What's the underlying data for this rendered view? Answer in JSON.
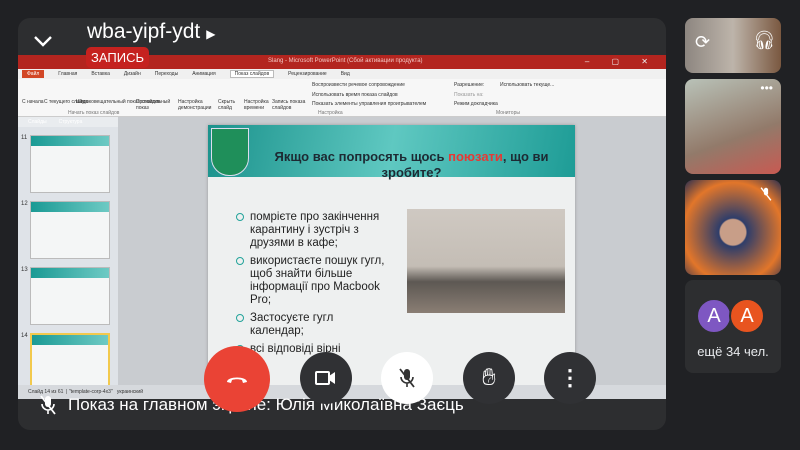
{
  "meeting": {
    "code": "wba-yipf-ydt",
    "recording_label": "ЗАПИСЬ",
    "presenting_caption": "Показ на главном экране: Юлія Миколаївна Заєць"
  },
  "powerpoint": {
    "window_title": "Slang - Microsoft PowerPoint (Сбой активации продукта)",
    "tabs": [
      "Файл",
      "Главная",
      "Вставка",
      "Дизайн",
      "Переходы",
      "Анимация",
      "Показ слайдов",
      "Рецензирование",
      "Вид"
    ],
    "active_tab": "Показ слайдов",
    "ribbon": {
      "start_group": {
        "label": "Начать показ слайдов",
        "buttons": [
          "С начала",
          "С текущего слайда",
          "Широковещательный показ слайдов",
          "Произвольный показ"
        ]
      },
      "setup_group": {
        "label": "Настройка",
        "buttons": [
          "Настройка демонстрации",
          "Скрыть слайд",
          "Настройка времени",
          "Запись показа слайдов"
        ],
        "checkboxes": [
          "Воспроизвести речевое сопровождение",
          "Использовать время показа слайдов",
          "Показать элементы управления проигрывателем"
        ]
      },
      "monitors_group": {
        "label": "Мониторы",
        "resolution_label": "Разрешение:",
        "resolution_value": "Использовать текуще...",
        "show_on_label": "Показать на:",
        "presenter_view": "Режим докладчика"
      }
    },
    "pane_tabs": [
      "Слайды",
      "Структура"
    ],
    "thumbnails": [
      "11",
      "12",
      "13",
      "14"
    ],
    "status": {
      "slide": "Слайд 14 из 61",
      "theme": "\"template-corp-4x3\"",
      "lang": "украинский"
    },
    "slide": {
      "title_before": "Якщо вас попросять щось ",
      "title_highlight": "поюзати",
      "title_after": ", що ви зробите?",
      "bullets": [
        "помрієте про закінчення карантину і зустріч з друзями в кафе;",
        "використаєте пошук гугл, щоб знайти більше інформації про Macbook Pro;",
        "Застосуєте гугл календар;",
        "всі відповіді вірні"
      ]
    }
  },
  "participants": {
    "avatars": [
      {
        "letter": "A",
        "color": "#7e57c2"
      },
      {
        "letter": "A",
        "color": "#e8541f"
      }
    ],
    "more_label": "ещё 34 чел."
  },
  "colors": {
    "end_call": "#ea4335",
    "record": "#c5221f",
    "background": "#202124"
  }
}
